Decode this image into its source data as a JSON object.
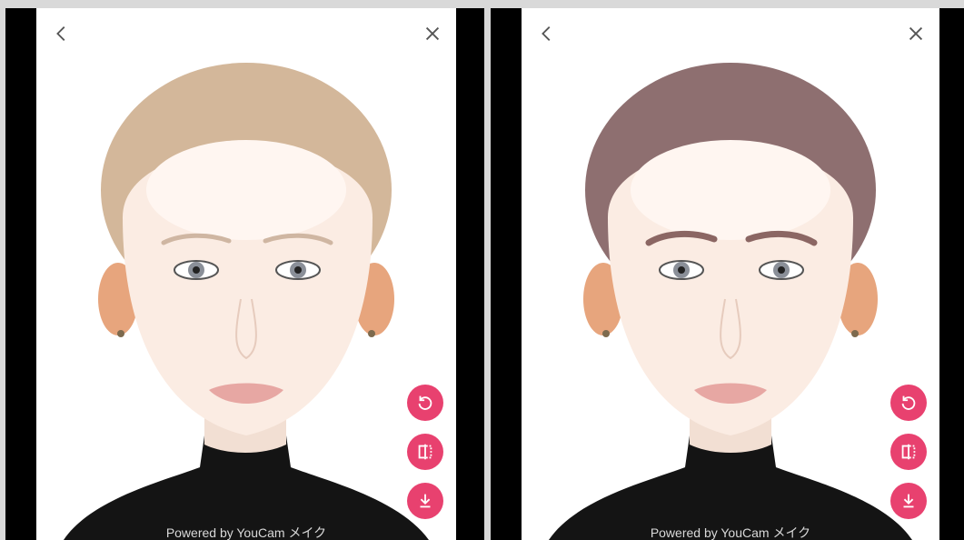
{
  "panels": [
    {
      "id": "before",
      "watermark": "Powered by YouCam メイク",
      "icons": {
        "back": "chevron-left-icon",
        "close": "close-icon",
        "reset": "reset-icon",
        "compare": "compare-icon",
        "download": "download-icon"
      },
      "colors": {
        "hair": "#d3b79a",
        "brows": "#cfb6a2"
      }
    },
    {
      "id": "after",
      "watermark": "Powered by YouCam メイク",
      "icons": {
        "back": "chevron-left-icon",
        "close": "close-icon",
        "reset": "reset-icon",
        "compare": "compare-icon",
        "download": "download-icon"
      },
      "colors": {
        "hair": "#8e6f70",
        "brows": "#8b6663"
      }
    }
  ],
  "theme": {
    "accent": "#e8416f",
    "background": "#000000",
    "photo_bg": "#ffffff"
  }
}
